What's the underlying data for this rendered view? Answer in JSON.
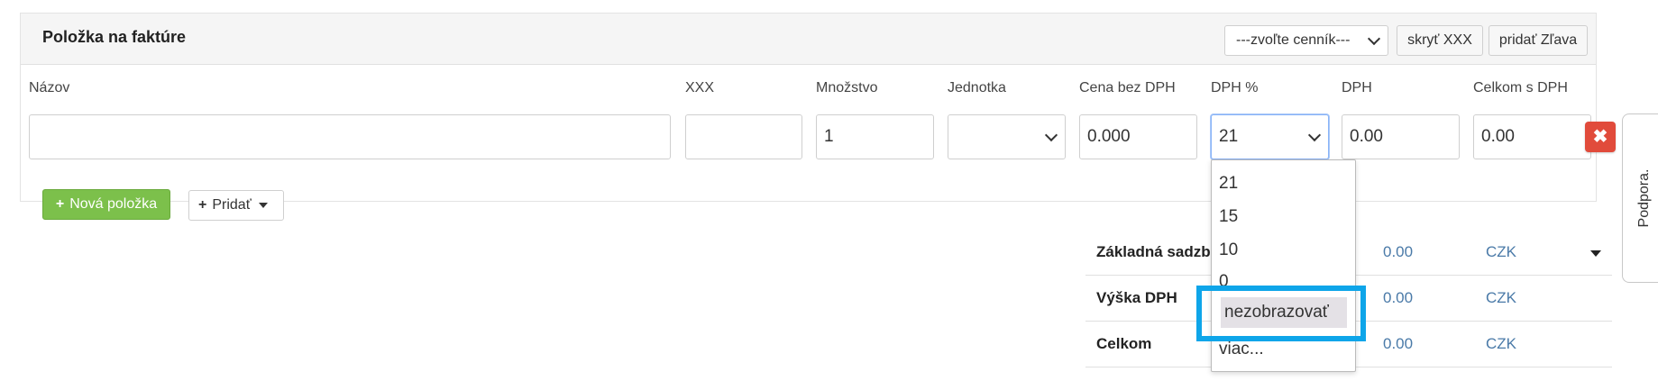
{
  "panel": {
    "title": "Položka na faktúre",
    "pricelist_select": "---zvoľte cenník---",
    "hide_button": "skryť XXX",
    "discount_button": "pridať Zľava"
  },
  "columns": {
    "name": "Názov",
    "xxx": "XXX",
    "quantity": "Množstvo",
    "unit": "Jednotka",
    "price_no_vat": "Cena bez DPH",
    "vat_percent": "DPH %",
    "vat": "DPH",
    "total_with_vat": "Celkom s DPH"
  },
  "row": {
    "name": "",
    "xxx": "",
    "quantity": "1",
    "unit": "",
    "price_no_vat": "0.000",
    "vat_percent": "21",
    "vat": "0.00",
    "total_with_vat": "0.00",
    "delete_icon": "✖"
  },
  "vat_dropdown": {
    "options": [
      "21",
      "15",
      "10",
      "0",
      "nezobrazovať",
      "viac..."
    ],
    "highlighted": "nezobrazovať"
  },
  "actions": {
    "new_item": "Nová položka",
    "add": "Pridať"
  },
  "summary": [
    {
      "label": "Základná sadzba",
      "value": "0.00",
      "currency": "CZK"
    },
    {
      "label": "Výška DPH",
      "value": "0.00",
      "currency": "CZK"
    },
    {
      "label": "Celkom",
      "value": "0.00",
      "currency": "CZK"
    }
  ],
  "support_tab": "Podpora.",
  "colors": {
    "green_button": "#7cc04b",
    "delete_button": "#e14b3b",
    "highlight_border": "#0ea5e9",
    "link_blue": "#4a7aa8"
  }
}
